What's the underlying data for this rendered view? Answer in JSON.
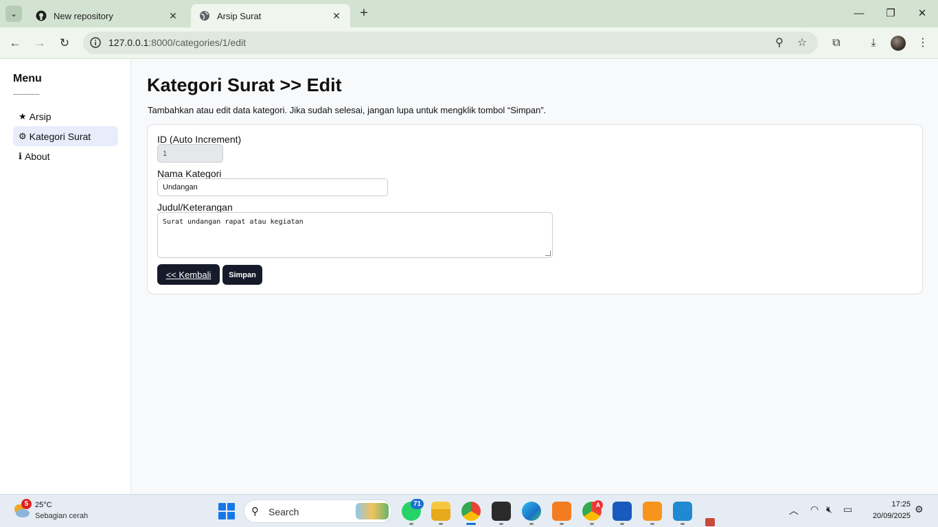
{
  "browser": {
    "tabs": [
      {
        "title": "New repository",
        "favicon": "github-icon",
        "active": false
      },
      {
        "title": "Arsip Surat",
        "favicon": "globe-icon",
        "active": true
      }
    ],
    "url_host": "127.0.0.1",
    "url_rest": ":8000/categories/1/edit"
  },
  "sidebar": {
    "title": "Menu",
    "separator": "----------",
    "items": [
      {
        "icon": "★",
        "label": "Arsip",
        "active": false
      },
      {
        "icon": "⚙",
        "label": "Kategori Surat",
        "active": true
      },
      {
        "icon": "ℹ",
        "label": "About",
        "active": false
      }
    ]
  },
  "main": {
    "title": "Kategori Surat >> Edit",
    "description": "Tambahkan atau edit data kategori. Jika sudah selesai, jangan lupa untuk mengklik tombol “Simpan”.",
    "form": {
      "id_label": "ID (Auto Increment)",
      "id_value": "1",
      "nama_label": "Nama Kategori",
      "nama_value": "Undangan",
      "judul_label": "Judul/Keterangan",
      "judul_value": "Surat undangan rapat atau kegiatan",
      "back_label": "<< Kembali",
      "save_label": "Simpan"
    }
  },
  "taskbar": {
    "weather_badge": "5",
    "temperature": "25°C",
    "weather_desc": "Sebagian cerah",
    "search_placeholder": "Search",
    "whatsapp_badge": "71",
    "chrome_badge": "A",
    "time": "17:25",
    "date": "20/09/2025"
  },
  "colors": {
    "accent_dark": "#161b2b",
    "active_menu": "#e8ecfb",
    "chrome_green": "#d3e3d1"
  }
}
